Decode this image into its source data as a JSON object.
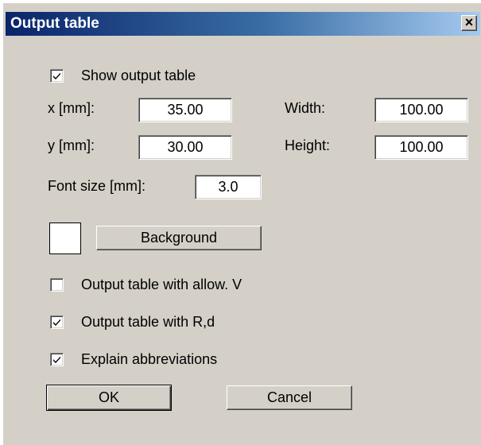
{
  "window": {
    "title": "Output table",
    "close_label": "×"
  },
  "show_output_table": {
    "label": "Show output table",
    "checked": true
  },
  "fields": {
    "x": {
      "label": "x [mm]:",
      "value": "35.00"
    },
    "y": {
      "label": "y [mm]:",
      "value": "30.00"
    },
    "width": {
      "label": "Width:",
      "value": "100.00"
    },
    "height": {
      "label": "Height:",
      "value": "100.00"
    },
    "font_size": {
      "label": "Font size [mm]:",
      "value": "3.0"
    }
  },
  "background": {
    "button_label": "Background",
    "swatch_color": "#ffffff"
  },
  "options": [
    {
      "label": "Output table with allow. V",
      "checked": false
    },
    {
      "label": "Output table with R,d",
      "checked": true
    },
    {
      "label": "Explain abbreviations",
      "checked": true
    }
  ],
  "buttons": {
    "ok": "OK",
    "cancel": "Cancel"
  }
}
